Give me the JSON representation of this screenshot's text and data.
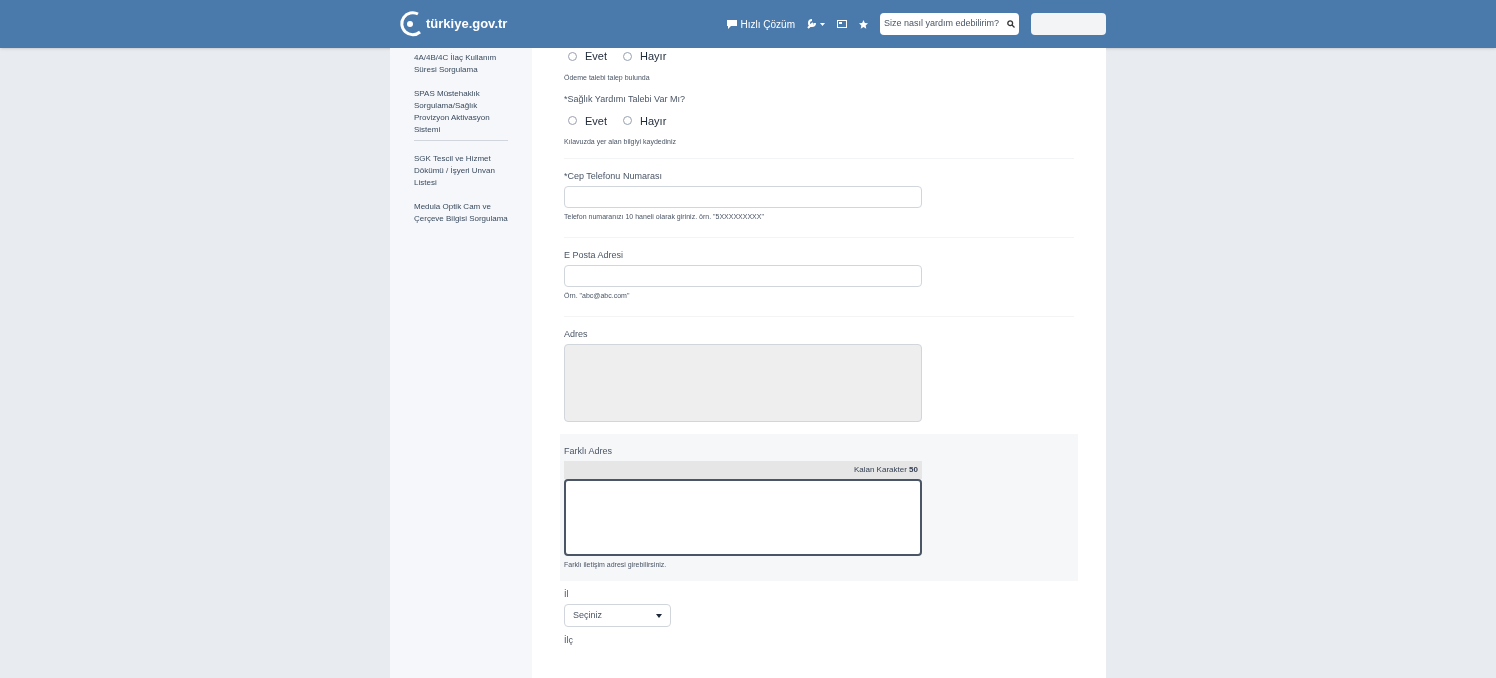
{
  "header": {
    "logo": "türkiye.gov.tr",
    "quick_solution": "Hızlı Çözüm",
    "search": {
      "placeholder": "Size nasıl yardım edebilirim?"
    }
  },
  "sidebar": {
    "items": [
      {
        "label": "4A/4B/4C İlaç Kullanım Süresi Sorgulama",
        "divider_after": false
      },
      {
        "label": "SPAS Müstehaklık Sorgulama/Sağlık Provizyon Aktivasyon Sistemi",
        "divider_after": true
      },
      {
        "label": "SGK Tescil ve Hizmet Dökümü / İşyeri Unvan Listesi",
        "divider_after": false
      },
      {
        "label": "Medula Optik Cam ve Çerçeve Bilgisi Sorgulama",
        "divider_after": false
      }
    ]
  },
  "form": {
    "fields": [
      {
        "kind": "radio",
        "options": [
          {
            "label": "Evet",
            "selected": false
          },
          {
            "label": "Hayır",
            "selected": false
          }
        ],
        "hint": "Ödeme talebi talep bulunda"
      },
      {
        "kind": "radio",
        "label": "*Sağlık Yardımı Talebi Var Mı?",
        "options": [
          {
            "label": "Evet",
            "selected": false
          },
          {
            "label": "Hayır",
            "selected": false
          }
        ],
        "hint": "Kılavuzda yer alan bilgiyi kaydediniz"
      },
      {
        "kind": "text",
        "label": "*Cep Telefonu Numarası",
        "hint": "Telefon numaranızı 10 haneli olarak giriniz. örn. \"5XXXXXXXXX\""
      },
      {
        "kind": "text",
        "label": "E Posta Adresi",
        "hint": "Örn. \"abc@abc.com\""
      },
      {
        "kind": "textarea",
        "label": "Adres",
        "disabled": true
      },
      {
        "kind": "counter_textarea",
        "label": "Farklı Adres",
        "counter_label": "Kalan Karakter",
        "counter_value": "50",
        "hint": "Farklı iletişim adresi girebilirsiniz."
      },
      {
        "kind": "select",
        "label": "İl",
        "value": "Seçiniz"
      },
      {
        "kind": "label",
        "label": "İlç"
      }
    ]
  }
}
